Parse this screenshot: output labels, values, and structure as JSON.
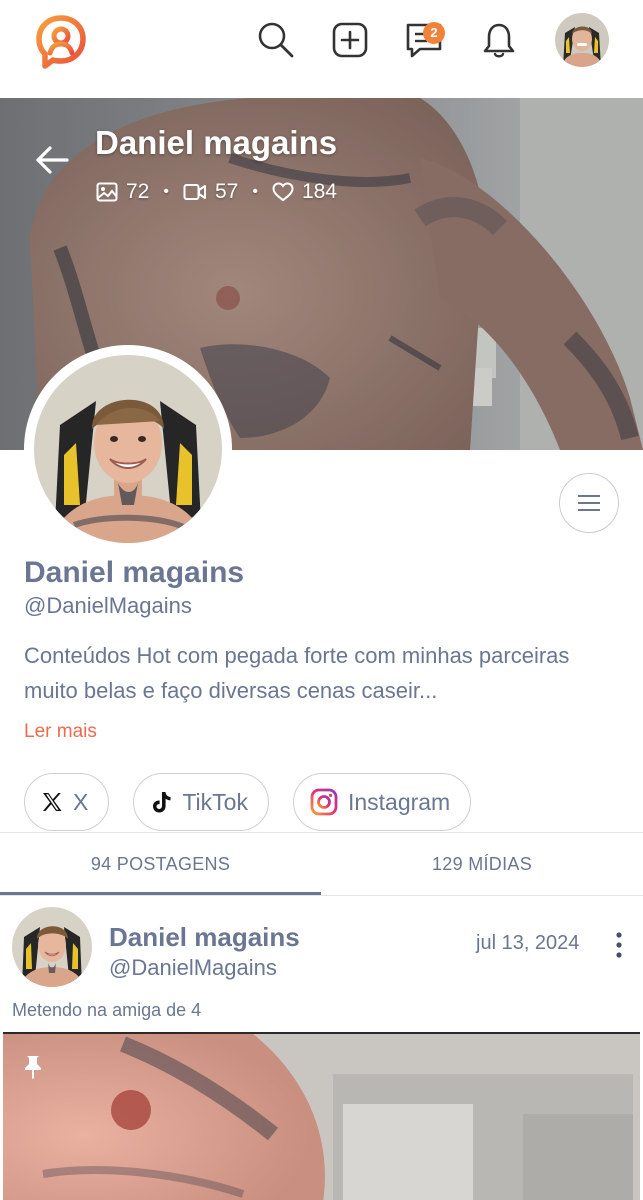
{
  "nav": {
    "message_badge": "2"
  },
  "cover": {
    "title": "Daniel magains",
    "stats": {
      "photos": "72",
      "videos": "57",
      "likes": "184"
    }
  },
  "profile": {
    "name": "Daniel magains",
    "handle": "@DanielMagains",
    "bio": "Conteúdos Hot com pegada forte com minhas parceiras muito belas e faço diversas cenas caseir...",
    "read_more": "Ler mais"
  },
  "socials": [
    {
      "label": "X",
      "icon": "x-logo-icon"
    },
    {
      "label": "TikTok",
      "icon": "tiktok-icon"
    },
    {
      "label": "Instagram",
      "icon": "instagram-icon"
    }
  ],
  "tabs": [
    {
      "label": "94 POSTAGENS",
      "active": true
    },
    {
      "label": "129 MÍDIAS",
      "active": false
    }
  ],
  "post": {
    "author_name": "Daniel magains",
    "author_handle": "@DanielMagains",
    "date": "jul 13, 2024",
    "caption": "Metendo na amiga de 4"
  },
  "colors": {
    "accent": "#ef6a4f",
    "badge": "#f0823a",
    "text": "#6a7692"
  }
}
